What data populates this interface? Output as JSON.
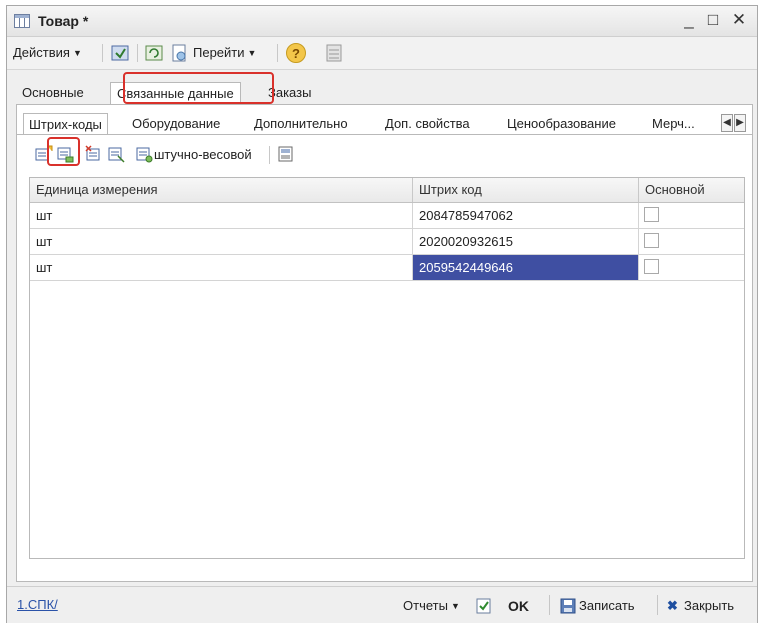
{
  "window": {
    "title": "Товар *",
    "controls": {
      "minimize": "_",
      "maximize": "□",
      "close": "✕"
    }
  },
  "toolbar": {
    "actions_label": "Действия",
    "goto_label": "Перейти",
    "help_label": "?"
  },
  "tabs": [
    {
      "label": "Основные",
      "active": false
    },
    {
      "label": "Связанные данные",
      "active": true
    },
    {
      "label": "Заказы",
      "active": false
    }
  ],
  "subtabs": [
    {
      "label": "Штрих-коды",
      "active": true
    },
    {
      "label": "Оборудование",
      "active": false
    },
    {
      "label": "Дополнительно",
      "active": false
    },
    {
      "label": "Доп. свойства",
      "active": false
    },
    {
      "label": "Ценообразование",
      "active": false
    },
    {
      "label": "Мерч...",
      "active": false
    }
  ],
  "table_toolbar": {
    "weight_label": "штучно-весовой"
  },
  "table": {
    "columns": [
      "Единица измерения",
      "Штрих код",
      "Основной"
    ],
    "rows": [
      {
        "unit": "шт",
        "barcode": "2084785947062",
        "main": false,
        "selected": false
      },
      {
        "unit": "шт",
        "barcode": "2020020932615",
        "main": false,
        "selected": false
      },
      {
        "unit": "шт",
        "barcode": "2059542449646",
        "main": false,
        "selected": true
      }
    ]
  },
  "bottombar": {
    "link_label": "1.СПК/",
    "reports_label": "Отчеты",
    "ok_label": "OK",
    "save_label": "Записать",
    "close_label": "Закрыть"
  },
  "colors": {
    "selection": "#3f4fa2",
    "highlight": "#d9312b",
    "link": "#2a52a8"
  }
}
